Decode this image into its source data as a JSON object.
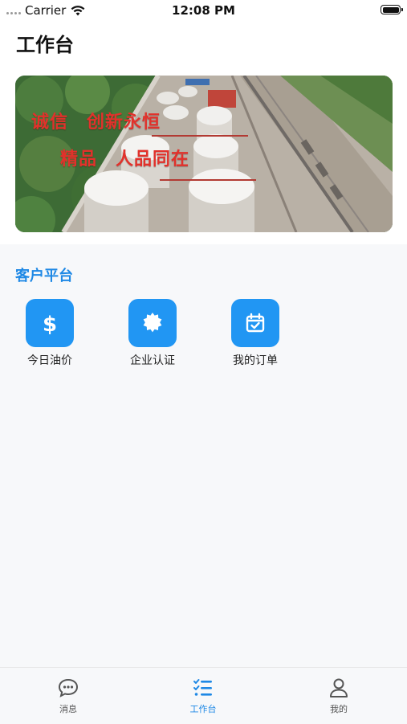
{
  "status_bar": {
    "carrier": "Carrier",
    "time": "12:08 PM"
  },
  "header": {
    "title": "工作台"
  },
  "banner": {
    "slogan_line1": "诚信　创新永恒",
    "slogan_line2": "精品　人品同在"
  },
  "section": {
    "title": "客户平台",
    "items": [
      {
        "label": "今日油价",
        "icon": "dollar-icon"
      },
      {
        "label": "企业认证",
        "icon": "badge-icon"
      },
      {
        "label": "我的订单",
        "icon": "calendar-check-icon"
      }
    ]
  },
  "tab_bar": {
    "items": [
      {
        "label": "消息",
        "icon": "chat-bubble-icon",
        "active": false
      },
      {
        "label": "工作台",
        "icon": "checklist-icon",
        "active": true
      },
      {
        "label": "我的",
        "icon": "person-icon",
        "active": false
      }
    ]
  },
  "colors": {
    "accent": "#1e88e5",
    "slogan": "#e2312b"
  }
}
